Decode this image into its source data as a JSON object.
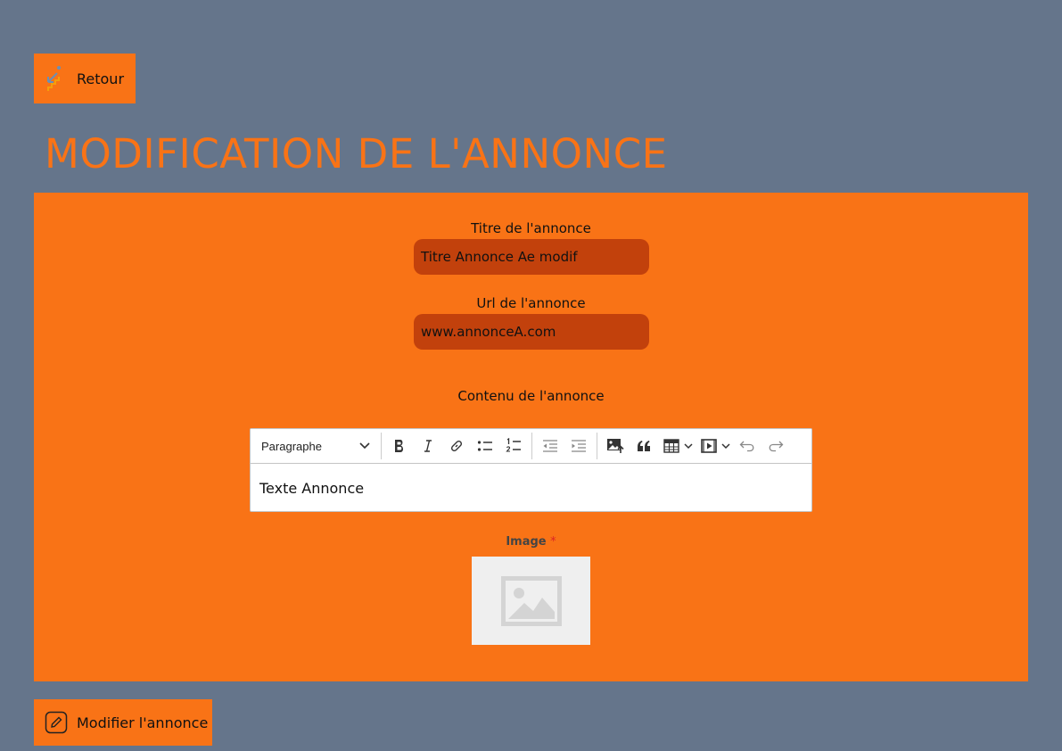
{
  "back_button": {
    "label": "Retour",
    "icon": "stairs-icon"
  },
  "page_title": "MODIFICATION DE L'ANNONCE",
  "form": {
    "title_label": "Titre de l'annonce",
    "title_value": "Titre Annonce Ae modif",
    "url_label": "Url de l'annonce",
    "url_value": "www.annonceA.com",
    "content_label": "Contenu de l'annonce",
    "editor": {
      "paragraph_select": "Paragraphe",
      "content": "Texte Annonce",
      "toolbar_icons": [
        "bold-icon",
        "italic-icon",
        "link-icon",
        "bulleted-list-icon",
        "numbered-list-icon",
        "outdent-icon",
        "indent-icon",
        "insert-image-icon",
        "blockquote-icon",
        "table-icon",
        "media-embed-icon",
        "undo-icon",
        "redo-icon"
      ]
    },
    "image_label": "Image",
    "image_required_mark": "*"
  },
  "submit_button": {
    "label": "Modifier l'annonce",
    "icon": "edit-pencil-icon"
  },
  "colors": {
    "background": "#65758b",
    "accent": "#f97316",
    "input_bg": "#c2410c"
  }
}
